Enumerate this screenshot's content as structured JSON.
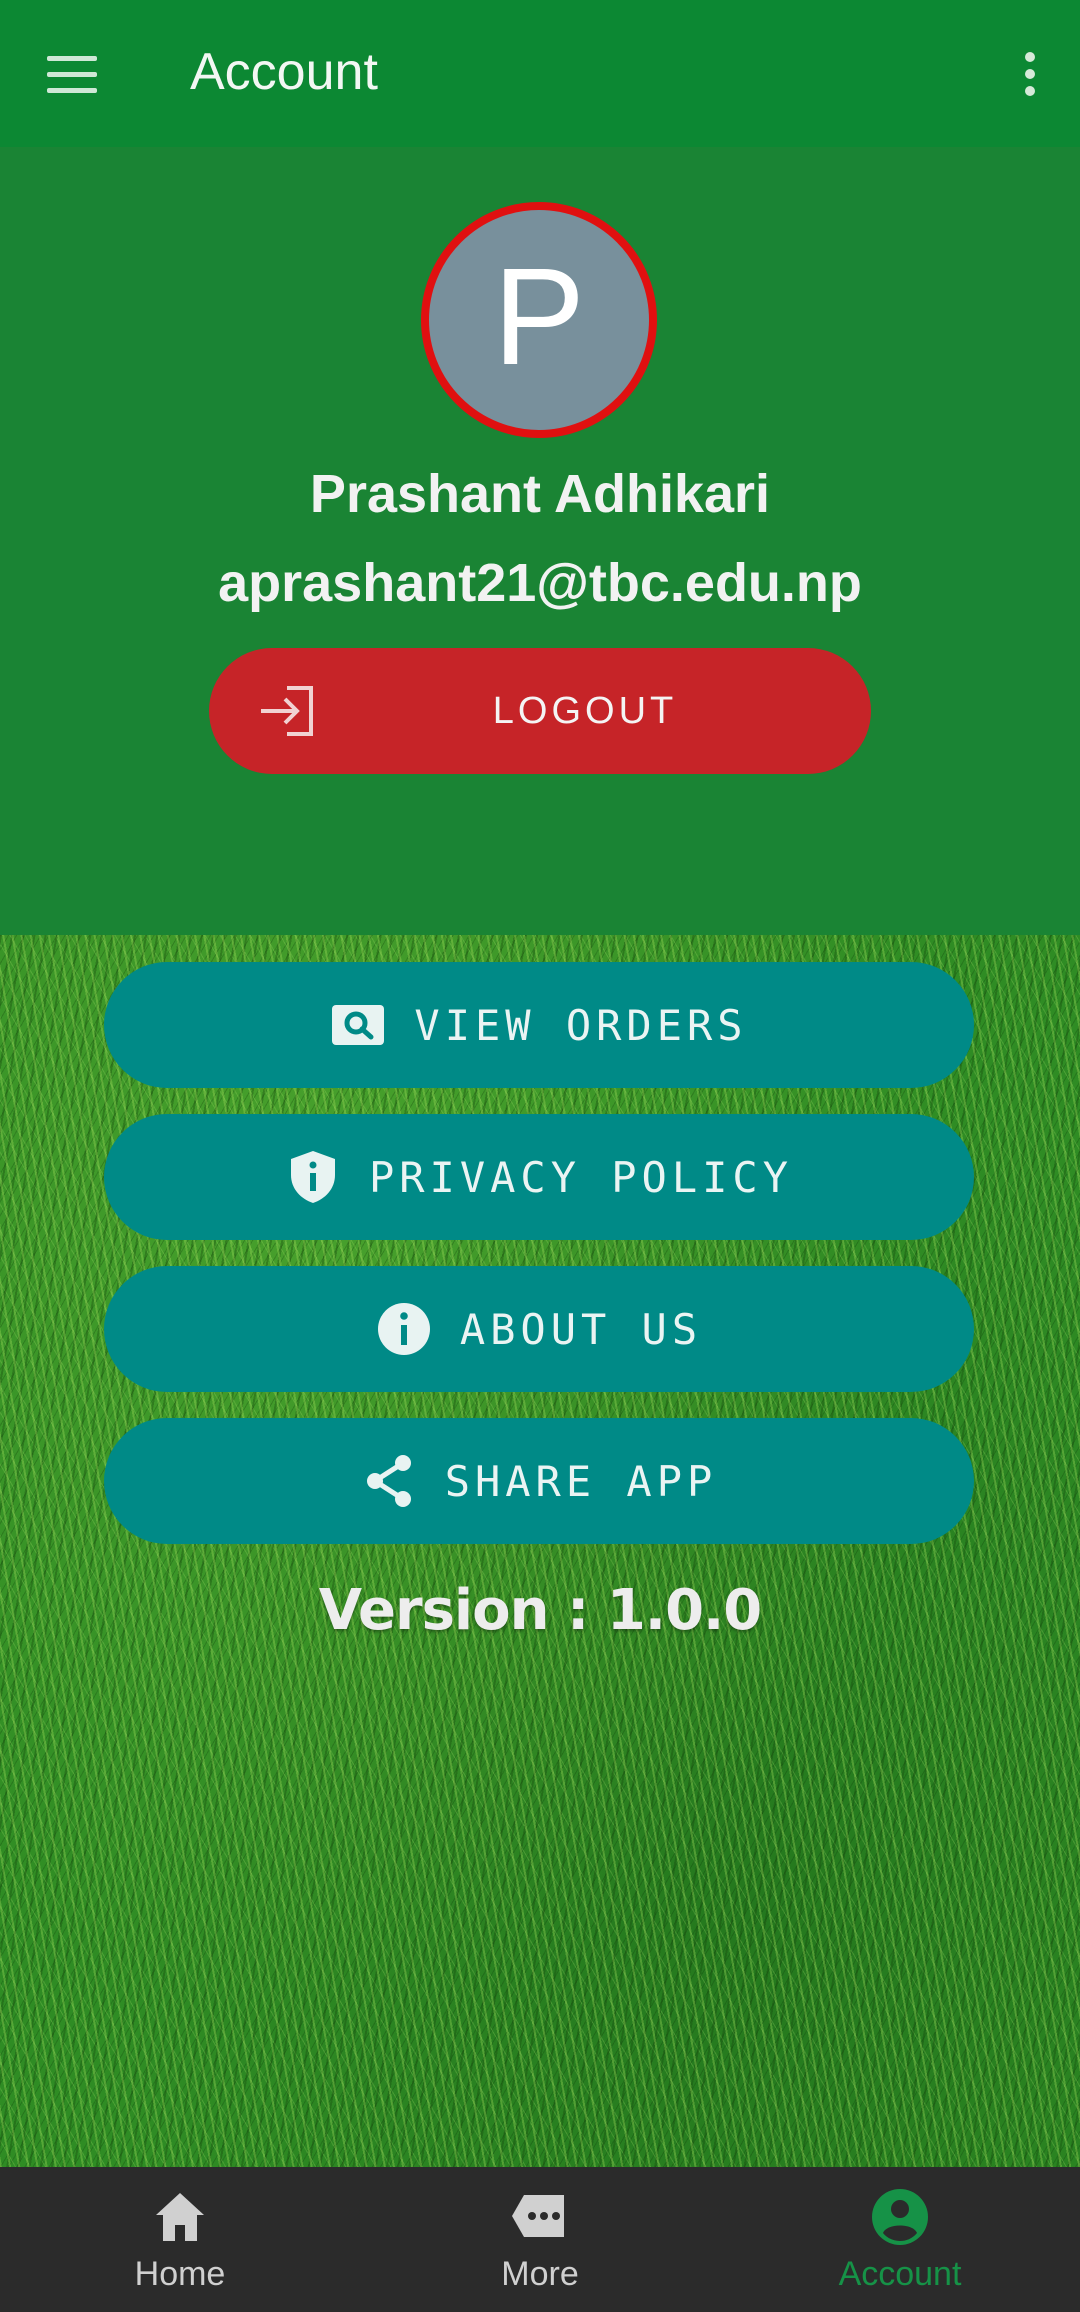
{
  "appbar": {
    "title": "Account",
    "menu_icon": "hamburger-menu-icon",
    "overflow_icon": "more-vert-icon"
  },
  "profile": {
    "avatar_initial": "P",
    "name": "Prashant Adhikari",
    "email": "aprashant21@tbc.edu.np",
    "logout_label": "LOGOUT",
    "logout_icon": "login-arrow-icon"
  },
  "menu": {
    "items": [
      {
        "label": "VIEW ORDERS",
        "icon": "image-search-icon"
      },
      {
        "label": "PRIVACY POLICY",
        "icon": "shield-info-icon"
      },
      {
        "label": "ABOUT US",
        "icon": "info-icon"
      },
      {
        "label": "SHARE APP",
        "icon": "share-icon"
      }
    ]
  },
  "version_text": "Version : 1.0.0",
  "bottom_nav": {
    "items": [
      {
        "label": "Home",
        "icon": "home-icon",
        "active": false
      },
      {
        "label": "More",
        "icon": "chat-bubble-icon",
        "active": false
      },
      {
        "label": "Account",
        "icon": "account-circle-icon",
        "active": true
      }
    ]
  },
  "colors": {
    "appbar": "#0c8833",
    "profile_bg": "#1a8434",
    "logout_button": "#c62428",
    "menu_button": "#008a87",
    "active_nav": "#169247",
    "avatar_ring": "#e01010",
    "avatar_fill": "#78909c"
  }
}
